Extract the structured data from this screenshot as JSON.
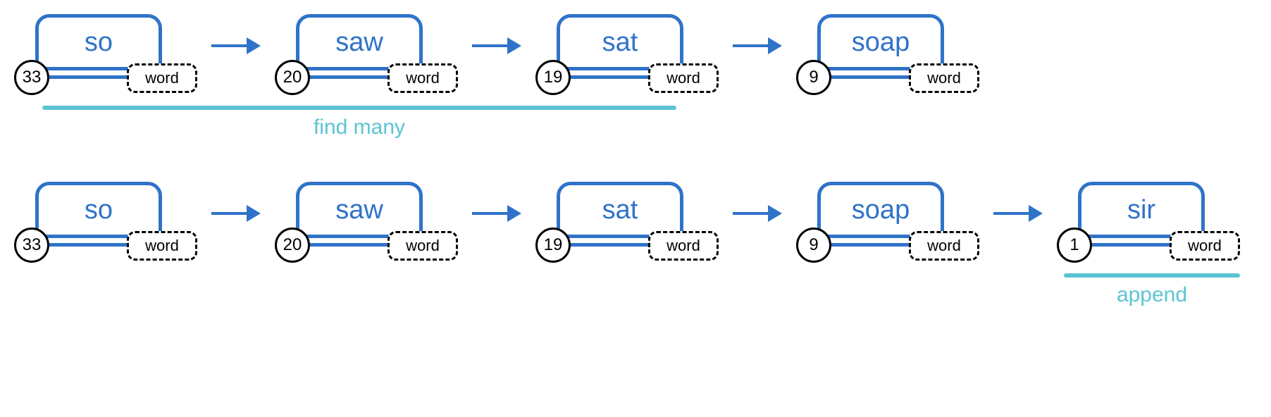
{
  "row1": {
    "nodes": [
      {
        "word": "so",
        "count": "33",
        "tag": "word"
      },
      {
        "word": "saw",
        "count": "20",
        "tag": "word"
      },
      {
        "word": "sat",
        "count": "19",
        "tag": "word"
      },
      {
        "word": "soap",
        "count": "9",
        "tag": "word"
      }
    ],
    "annotation": "find many"
  },
  "row2": {
    "nodes": [
      {
        "word": "so",
        "count": "33",
        "tag": "word"
      },
      {
        "word": "saw",
        "count": "20",
        "tag": "word"
      },
      {
        "word": "sat",
        "count": "19",
        "tag": "word"
      },
      {
        "word": "soap",
        "count": "9",
        "tag": "word"
      },
      {
        "word": "sir",
        "count": "1",
        "tag": "word"
      }
    ],
    "annotation": "append"
  }
}
